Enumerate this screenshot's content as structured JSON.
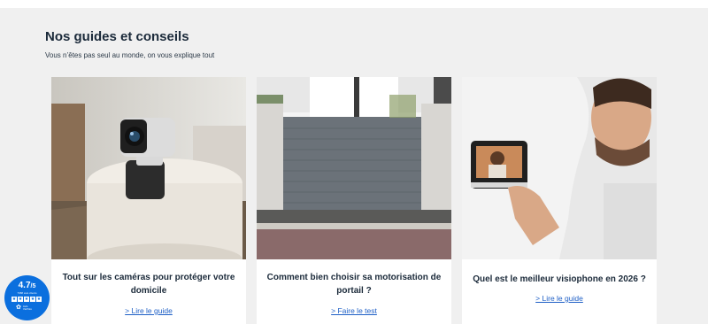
{
  "section": {
    "title": "Nos guides et conseils",
    "subtitle": "Vous n’êtes pas seul au monde, on vous explique tout"
  },
  "cards": [
    {
      "title": "Tout sur les caméras pour protéger votre domicile",
      "link": "> Lire le guide",
      "image_icon": "security-camera-photo"
    },
    {
      "title": "Comment bien choisir sa motorisation de portail ?",
      "link": "> Faire le test",
      "image_icon": "motorized-gate-photo"
    },
    {
      "title": "Quel est le meilleur visiophone en 2026 ?",
      "link": "> Lire le guide",
      "image_icon": "video-intercom-photo"
    }
  ],
  "rating": {
    "score": "4.7",
    "scale": "/5",
    "count_label": "7988 avis clients",
    "brand_line1": "Avis",
    "brand_line2": "Vérifiés",
    "stars": 5
  },
  "colors": {
    "page_bg": "#f0f0f0",
    "heading": "#1b2a3a",
    "link": "#1e5fc6",
    "badge": "#0b6fde"
  }
}
